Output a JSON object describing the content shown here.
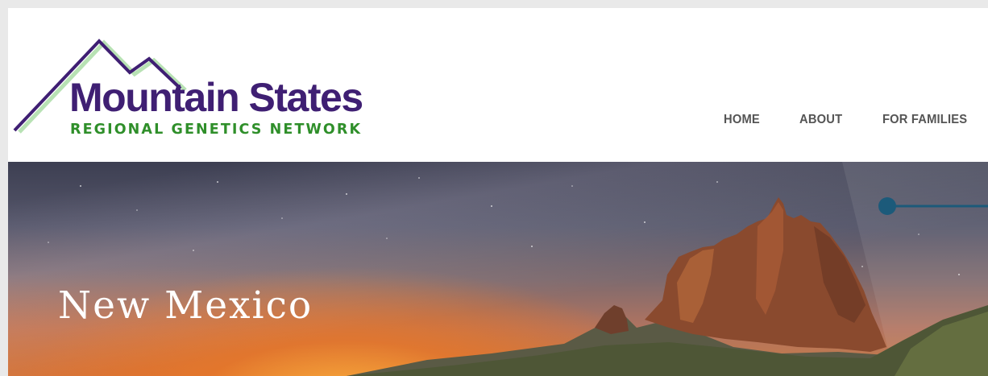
{
  "logo": {
    "title": "Mountain States",
    "subtitle": "REGIONAL GENETICS NETWORK",
    "icon": "mountain-peaks-logo"
  },
  "nav": {
    "items": [
      {
        "label": "HOME"
      },
      {
        "label": "ABOUT"
      },
      {
        "label": "FOR FAMILIES"
      }
    ]
  },
  "hero": {
    "title": "New Mexico"
  },
  "colors": {
    "brand_purple": "#3f1f73",
    "brand_green": "#2f8f2a",
    "nav_text": "#555555",
    "accent_blue": "#1c5a7a"
  }
}
